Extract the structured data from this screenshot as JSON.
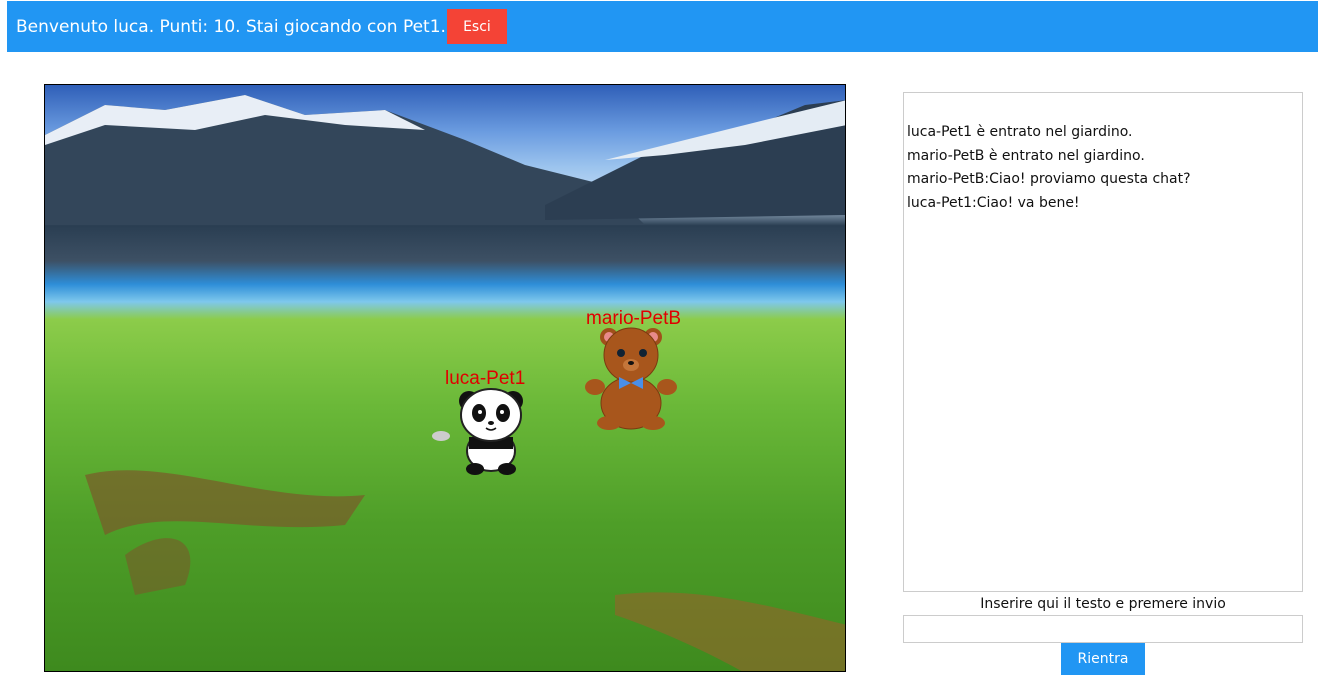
{
  "header": {
    "welcome": "Benvenuto luca. Punti: 10. Stai giocando con Pet1.",
    "logout_label": "Esci",
    "color": "#2196F3"
  },
  "game": {
    "pets": [
      {
        "label": "luca-Pet1",
        "kind": "panda"
      },
      {
        "label": "mario-PetB",
        "kind": "teddy-bear"
      }
    ]
  },
  "chat": {
    "messages": [
      "luca-Pet1 è entrato nel giardino.",
      "mario-PetB è entrato nel giardino.",
      "mario-PetB:Ciao! proviamo questa chat?",
      "luca-Pet1:Ciao! va bene!"
    ],
    "prompt": "Inserire qui il testo e premere invio",
    "input_value": "",
    "rejoin_label": "Rientra"
  }
}
